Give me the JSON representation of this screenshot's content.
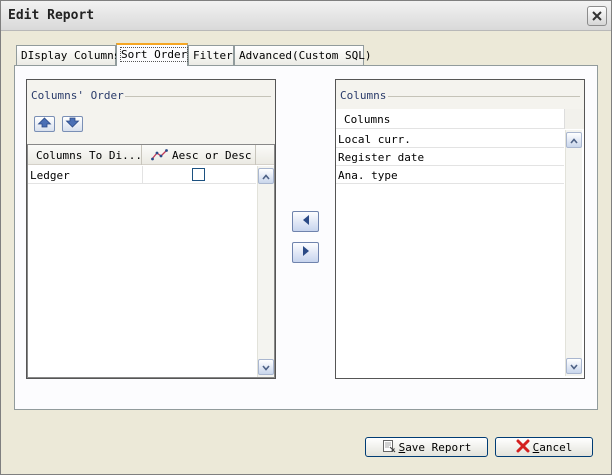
{
  "window": {
    "title": "Edit Report"
  },
  "tabs": [
    {
      "label": "DIsplay Columns",
      "active": false
    },
    {
      "label": "Sort Order",
      "active": true
    },
    {
      "label": "Filter",
      "active": false
    },
    {
      "label": "Advanced(Custom SQL)",
      "active": false
    }
  ],
  "left_group": {
    "title": "Columns' Order",
    "move_up_icon": "move-up-icon",
    "move_down_icon": "move-down-icon",
    "headers": [
      "Columns To Di...",
      "Aesc or Desc"
    ],
    "rows": [
      {
        "column": "Ledger",
        "desc_checked": false
      }
    ]
  },
  "right_group": {
    "title": "Columns",
    "header": "Columns",
    "rows": [
      "Local curr.",
      "Register date",
      "Ana. type"
    ]
  },
  "transfer": {
    "left_icon": "arrow-left-icon",
    "right_icon": "arrow-right-icon"
  },
  "actions": {
    "save_prefix": "S",
    "save_rest": "ave Report",
    "cancel_prefix": "C",
    "cancel_rest": "ancel"
  },
  "colors": {
    "accent_tab": "#f5a623",
    "cancel_x": "#d42020"
  }
}
